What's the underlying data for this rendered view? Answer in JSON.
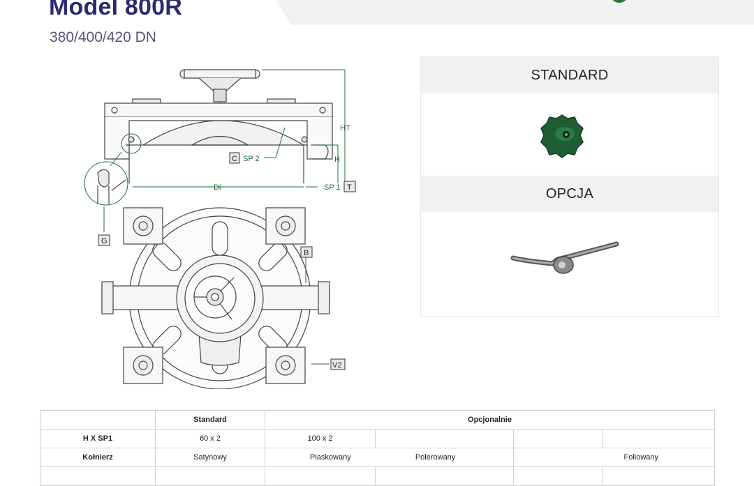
{
  "header": {
    "title": "Model 800R",
    "subtitle": "380/400/420 DN"
  },
  "drawing": {
    "labels": {
      "ht": "HT",
      "h": "H",
      "c": "C",
      "sp2": "SP 2",
      "di": "Di",
      "sp1": "SP 1",
      "t": "T",
      "g": "G",
      "b": "B",
      "v2": "V2"
    }
  },
  "panel": {
    "standard_label": "STANDARD",
    "option_label": "OPCJA",
    "standard_icon": "green-knob-icon",
    "option_icon": "lever-handle-icon"
  },
  "colors": {
    "title": "#2b2a6e",
    "dimension": "#1f6b3a",
    "knob": "#1f5e33"
  },
  "table": {
    "header": {
      "col_standard": "Standard",
      "col_optional": "Opcjonalnie"
    },
    "rows": [
      {
        "label": "H X SP1",
        "standard": "60 x 2",
        "opt1": "100 x 2",
        "opt2": "",
        "opt3": "",
        "opt4": ""
      },
      {
        "label": "Kołnierz",
        "standard": "Satynowy",
        "opt1": "Piaskowany",
        "opt2": "Polerowany",
        "opt3": "Foliowany"
      }
    ]
  }
}
